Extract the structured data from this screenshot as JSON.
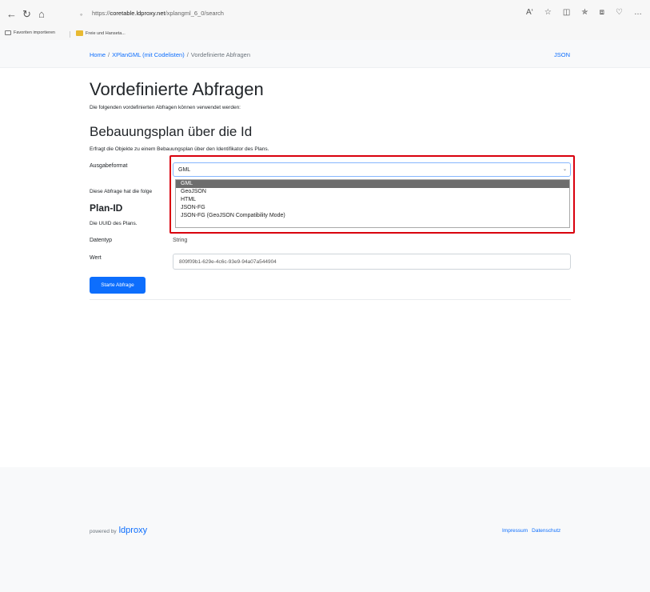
{
  "browser": {
    "url_prefix": "https://",
    "url_host": "coretable.ldproxy.net",
    "url_path": "/xplangml_6_0/search",
    "favorites": [
      "Favoriten importieren",
      "Freie und Hanseta..."
    ]
  },
  "header": {
    "breadcrumb": [
      "Home",
      "XPlanGML (mit Codelisten)",
      "Vordefinierte Abfragen"
    ],
    "json_link": "JSON"
  },
  "main": {
    "title": "Vordefinierte Abfragen",
    "lead": "Die folgenden vordefinierten Abfragen können verwendet werden:",
    "query_title": "Bebauungsplan über die Id",
    "query_desc": "Erfragt die Objekte zu einem Bebauungsplan über den Identifikator des Plans.",
    "format_label": "Ausgabeformat",
    "format_selected": "GML",
    "format_options": [
      "GML",
      "GeoJSON",
      "HTML",
      "JSON-FG",
      "JSON-FG (GeoJSON Compatibility Mode)"
    ],
    "param_info": "Diese Abfrage hat die folge",
    "param_title": "Plan-ID",
    "param_desc": "Die UUID des Plans.",
    "datatype_label": "Datentyp",
    "datatype_value": "String",
    "value_label": "Wert",
    "value_input": "809f09b1-629e-4c6c-93e9-94a07a544904",
    "submit_label": "Starte Abfrage"
  },
  "footer": {
    "powered_by": "powered by",
    "brand": "ldproxy",
    "links": [
      "Impressum",
      "Datenschutz"
    ]
  },
  "colors": {
    "accent": "#0d6efd",
    "highlight": "#d9000d"
  }
}
